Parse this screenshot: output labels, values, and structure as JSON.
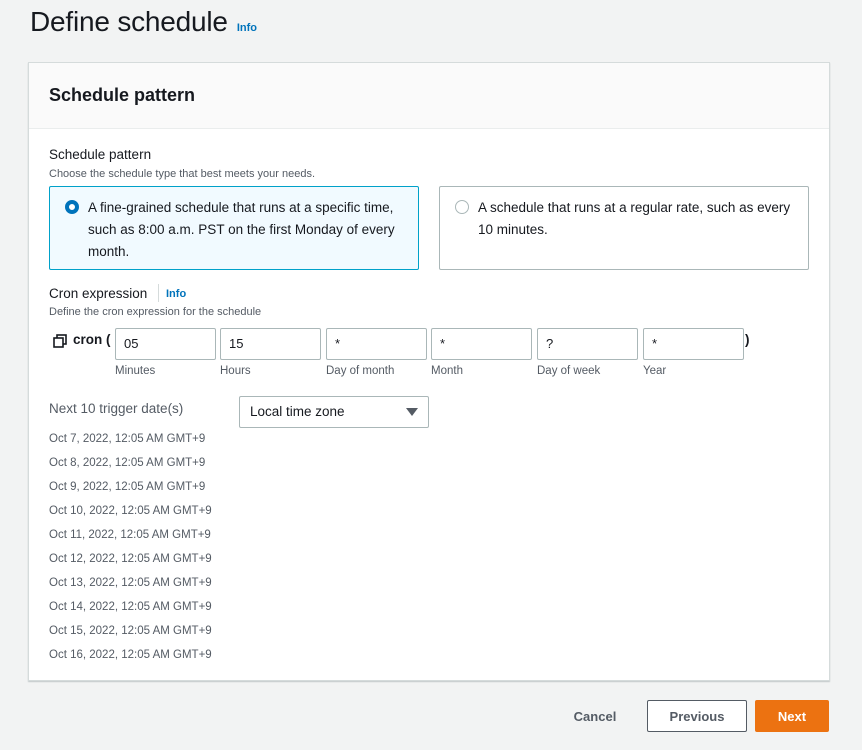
{
  "page": {
    "title": "Define schedule",
    "info": "Info"
  },
  "card": {
    "title": "Schedule pattern"
  },
  "pattern": {
    "label": "Schedule pattern",
    "description": "Choose the schedule type that best meets your needs.",
    "options": [
      {
        "text": "A fine-grained schedule that runs at a specific time, such as 8:00 a.m. PST on the first Monday of every month.",
        "selected": true
      },
      {
        "text": "A schedule that runs at a regular rate, such as every 10 minutes.",
        "selected": false
      }
    ]
  },
  "cron": {
    "label": "Cron expression",
    "info": "Info",
    "description": "Define the cron expression for the schedule",
    "prefix": "cron (",
    "suffix": ")",
    "fields": [
      {
        "value": "05",
        "caption": "Minutes"
      },
      {
        "value": "15",
        "caption": "Hours"
      },
      {
        "value": "*",
        "caption": "Day of month"
      },
      {
        "value": "*",
        "caption": "Month"
      },
      {
        "value": "?",
        "caption": "Day of week"
      },
      {
        "value": "*",
        "caption": "Year"
      }
    ]
  },
  "triggers": {
    "label": "Next 10 trigger date(s)",
    "timezone": "Local time zone",
    "dates": [
      "Oct 7, 2022, 12:05 AM GMT+9",
      "Oct 8, 2022, 12:05 AM GMT+9",
      "Oct 9, 2022, 12:05 AM GMT+9",
      "Oct 10, 2022, 12:05 AM GMT+9",
      "Oct 11, 2022, 12:05 AM GMT+9",
      "Oct 12, 2022, 12:05 AM GMT+9",
      "Oct 13, 2022, 12:05 AM GMT+9",
      "Oct 14, 2022, 12:05 AM GMT+9",
      "Oct 15, 2022, 12:05 AM GMT+9",
      "Oct 16, 2022, 12:05 AM GMT+9"
    ]
  },
  "actions": {
    "cancel": "Cancel",
    "previous": "Previous",
    "next": "Next"
  },
  "colors": {
    "primary": "#ec7211",
    "link": "#0073bb",
    "selected_border": "#00a1c9",
    "selected_bg": "#f1faff"
  }
}
